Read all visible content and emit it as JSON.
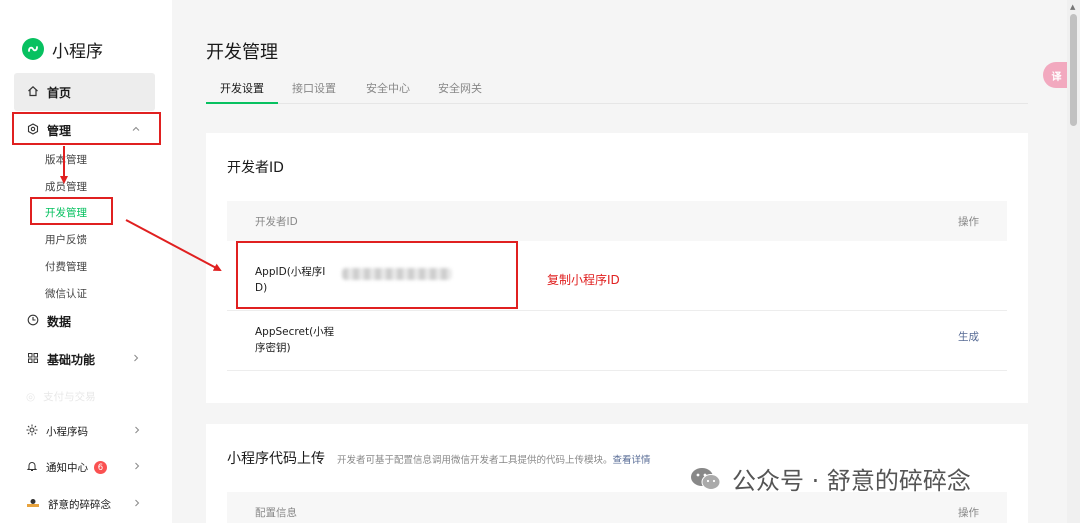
{
  "sidebar": {
    "brand": "小程序",
    "home": "首页",
    "manage": "管理",
    "manage_sub": [
      "版本管理",
      "成员管理",
      "开发管理",
      "用户反馈",
      "付费管理",
      "微信认证"
    ],
    "data": "数据",
    "basic": "基础功能",
    "faded": "支付与交易",
    "qrcode": "小程序码",
    "notice": "通知中心",
    "notice_count": "6",
    "account": "舒意的碎碎念"
  },
  "page": {
    "title": "开发管理",
    "tabs": [
      "开发设置",
      "接口设置",
      "安全中心",
      "安全网关"
    ]
  },
  "dev_id_card": {
    "title": "开发者ID",
    "col_id": "开发者ID",
    "col_action": "操作",
    "appid_label_1": "AppID(小程序I",
    "appid_label_2": "D)",
    "secret_label_1": "AppSecret(小程",
    "secret_label_2": "序密钥)",
    "secret_action": "生成"
  },
  "annotation": "复制小程序ID",
  "upload_card": {
    "title": "小程序代码上传",
    "hint": "开发者可基于配置信息调用微信开发者工具提供的代码上传模块。",
    "hint_link": "查看详情",
    "col_config": "配置信息",
    "col_action": "操作"
  },
  "watermark": "公众号 · 舒意的碎碎念",
  "translate": "译",
  "colors": {
    "accent": "#07c160",
    "annotation": "#e02020",
    "link": "#576b95"
  }
}
